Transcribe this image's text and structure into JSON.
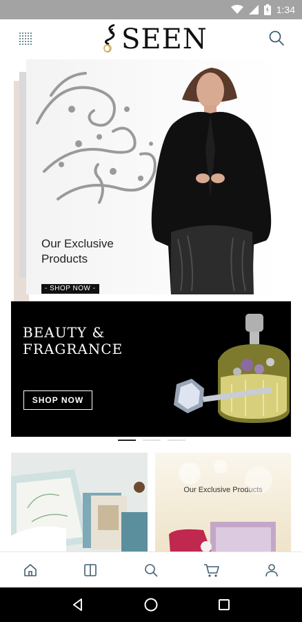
{
  "status_bar": {
    "time": "1:34"
  },
  "header": {
    "logo_text": "SEEN"
  },
  "hero": {
    "caption_line1": "Our Exclusive",
    "caption_line2": "Products",
    "shop_label": "- SHOP NOW -"
  },
  "beauty": {
    "title_line1": "BEAUTY &",
    "title_line2": "FRAGRANCE",
    "shop_label": "SHOP NOW"
  },
  "pager": {
    "count": 3,
    "active": 0
  },
  "tiles": {
    "right_title": "Our Exclusive Products"
  },
  "bottom_nav": {
    "items": [
      "home-icon",
      "catalog-icon",
      "search-icon",
      "cart-icon",
      "account-icon"
    ]
  },
  "colors": {
    "icon": "#3f5f74",
    "status_bar": "#a3a3a3"
  }
}
